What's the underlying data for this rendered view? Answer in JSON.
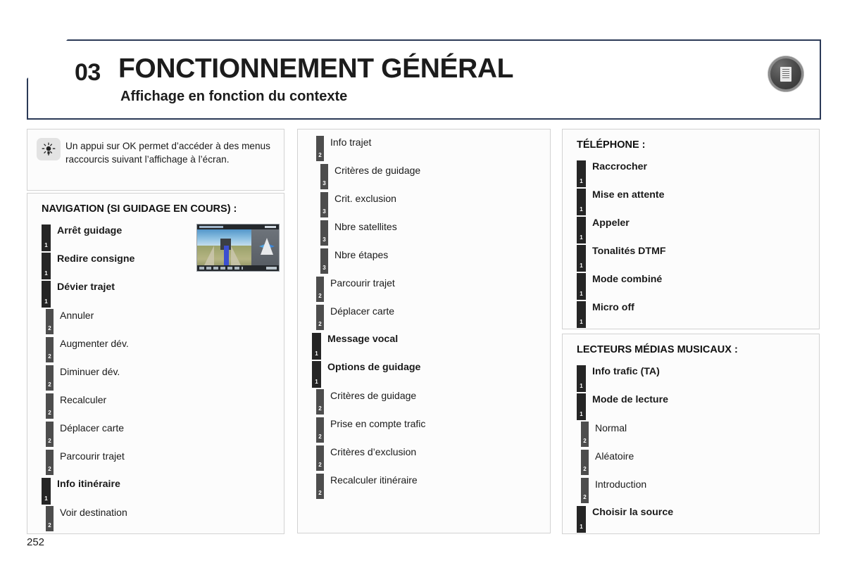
{
  "header": {
    "chapter_number": "03",
    "title": "FONCTIONNEMENT GÉNÉRAL",
    "subtitle": "Affichage en fonction du contexte",
    "badge_icon": "document-icon",
    "border_color": "#2b3a57"
  },
  "tip": {
    "icon": "lightbulb-icon",
    "text": "Un appui sur OK permet d’accéder à des menus raccourcis suivant l’affichage à l’écran."
  },
  "navigation_panel": {
    "title": "NAVIGATION (SI GUIDAGE EN COURS) :",
    "thumbnail_alt": "navigation-3d-screen",
    "items": [
      {
        "level": 1,
        "label": "Arrêt guidage"
      },
      {
        "level": 1,
        "label": "Redire consigne"
      },
      {
        "level": 1,
        "label": "Dévier trajet"
      },
      {
        "level": 2,
        "label": "Annuler"
      },
      {
        "level": 2,
        "label": "Augmenter dév."
      },
      {
        "level": 2,
        "label": "Diminuer dév."
      },
      {
        "level": 2,
        "label": "Recalculer"
      },
      {
        "level": 2,
        "label": "Déplacer carte"
      },
      {
        "level": 2,
        "label": "Parcourir trajet"
      },
      {
        "level": 1,
        "label": "Info itinéraire"
      },
      {
        "level": 2,
        "label": "Voir destination"
      }
    ]
  },
  "middle_panel": {
    "items": [
      {
        "level": 2,
        "label": "Info trajet"
      },
      {
        "level": 3,
        "label": "Critères de guidage"
      },
      {
        "level": 3,
        "label": "Crit. exclusion"
      },
      {
        "level": 3,
        "label": "Nbre satellites"
      },
      {
        "level": 3,
        "label": "Nbre étapes"
      },
      {
        "level": 2,
        "label": "Parcourir trajet"
      },
      {
        "level": 2,
        "label": "Déplacer carte"
      },
      {
        "level": 1,
        "label": "Message vocal"
      },
      {
        "level": 1,
        "label": "Options de guidage"
      },
      {
        "level": 2,
        "label": "Critères de guidage"
      },
      {
        "level": 2,
        "label": "Prise en compte trafic"
      },
      {
        "level": 2,
        "label": "Critères d’exclusion"
      },
      {
        "level": 2,
        "label": "Recalculer itinéraire"
      }
    ]
  },
  "phone_panel": {
    "title": "TÉLÉPHONE :",
    "items": [
      {
        "level": 1,
        "label": "Raccrocher"
      },
      {
        "level": 1,
        "label": "Mise en attente"
      },
      {
        "level": 1,
        "label": "Appeler"
      },
      {
        "level": 1,
        "label": "Tonalités DTMF"
      },
      {
        "level": 1,
        "label": "Mode combiné"
      },
      {
        "level": 1,
        "label": "Micro off"
      }
    ]
  },
  "media_panel": {
    "title": "LECTEURS MÉDIAS MUSICAUX :",
    "items": [
      {
        "level": 1,
        "label": "Info trafic (TA)"
      },
      {
        "level": 1,
        "label": "Mode de lecture"
      },
      {
        "level": 2,
        "label": "Normal"
      },
      {
        "level": 2,
        "label": "Aléatoire"
      },
      {
        "level": 2,
        "label": "Introduction"
      },
      {
        "level": 1,
        "label": "Choisir la source"
      }
    ]
  },
  "footer": {
    "page_number": "252"
  }
}
